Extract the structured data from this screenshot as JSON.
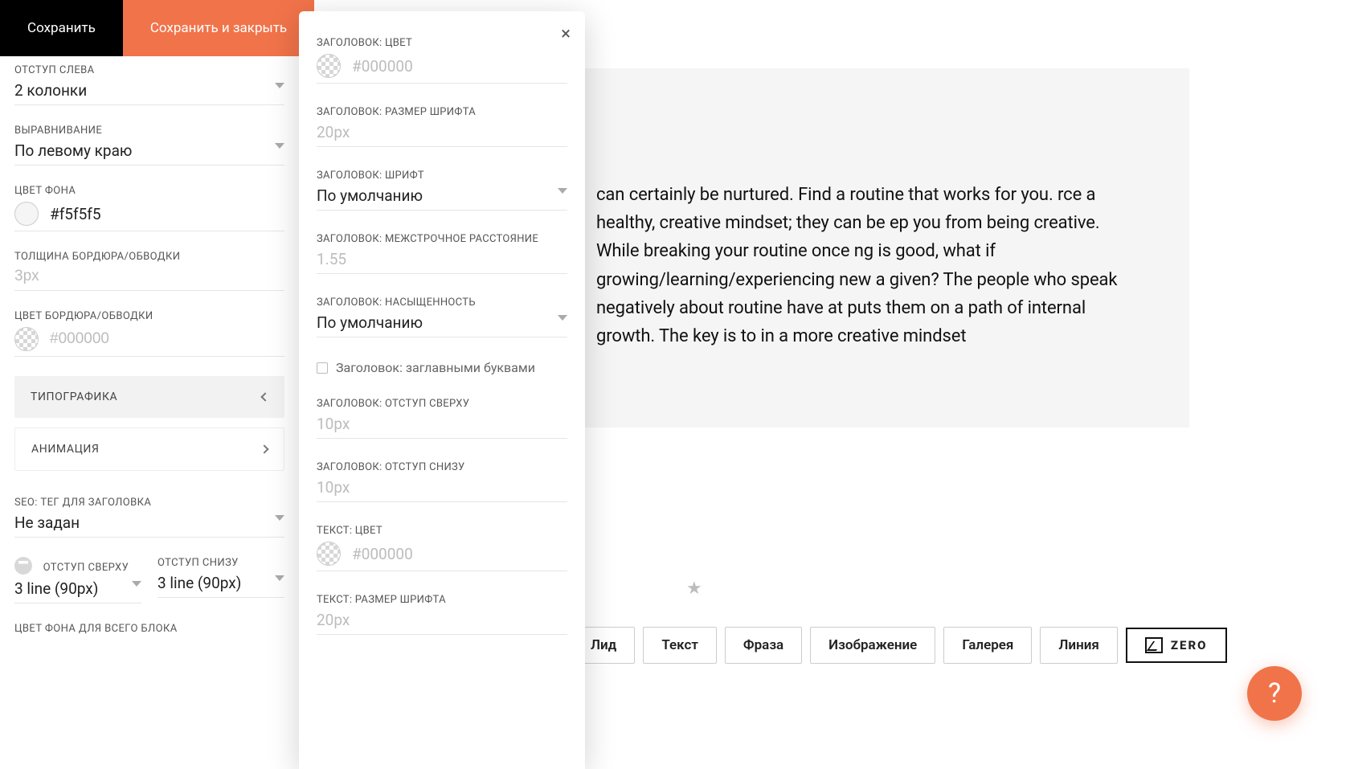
{
  "topbar": {
    "save": "Сохранить",
    "saveclose": "Сохранить и закрыть"
  },
  "sidebar": {
    "indent_left": {
      "label": "ОТСТУП СЛЕВА",
      "value": "2 колонки"
    },
    "align": {
      "label": "ВЫРАВНИВАНИЕ",
      "value": "По левому краю"
    },
    "bg_color": {
      "label": "ЦВЕТ ФОНА",
      "value": "#f5f5f5"
    },
    "border_w": {
      "label": "ТОЛЩИНА БОРДЮРА/ОБВОДКИ",
      "placeholder": "3px"
    },
    "border_c": {
      "label": "ЦВЕТ БОРДЮРА/ОБВОДКИ",
      "placeholder": "#000000"
    },
    "acc_typo": "ТИПОГРАФИКА",
    "acc_anim": "АНИМАЦИЯ",
    "seo": {
      "label": "SEO: ТЕГ ДЛЯ ЗАГОЛОВКА",
      "value": "Не задан"
    },
    "pad_top": {
      "label": "ОТСТУП СВЕРХУ",
      "value": "3 line (90px)"
    },
    "pad_bottom": {
      "label": "ОТСТУП СНИЗУ",
      "value": "3 line (90px)"
    },
    "block_bg": {
      "label": "ЦВЕТ ФОНА ДЛЯ ВСЕГО БЛОКА"
    }
  },
  "popup": {
    "title_color": {
      "label": "ЗАГОЛОВОК: ЦВЕТ",
      "placeholder": "#000000"
    },
    "title_size": {
      "label": "ЗАГОЛОВОК: РАЗМЕР ШРИФТА",
      "placeholder": "20px"
    },
    "title_font": {
      "label": "ЗАГОЛОВОК: ШРИФТ",
      "value": "По умолчанию"
    },
    "title_lh": {
      "label": "ЗАГОЛОВОК: МЕЖСТРОЧНОЕ РАССТОЯНИЕ",
      "placeholder": "1.55"
    },
    "title_weight": {
      "label": "ЗАГОЛОВОК: НАСЫЩЕННОСТЬ",
      "value": "По умолчанию"
    },
    "title_upper": "Заголовок: заглавными буквами",
    "title_mt": {
      "label": "ЗАГОЛОВОК: ОТСТУП СВЕРХУ",
      "placeholder": "10px"
    },
    "title_mb": {
      "label": "ЗАГОЛОВОК: ОТСТУП СНИЗУ",
      "placeholder": "10px"
    },
    "text_color": {
      "label": "ТЕКСТ: ЦВЕТ",
      "placeholder": "#000000"
    },
    "text_size": {
      "label": "ТЕКСТ: РАЗМЕР ШРИФТА",
      "placeholder": "20px"
    }
  },
  "canvas_text": " can certainly be nurtured. Find a routine that works for you. rce a healthy, creative mindset; they can be ep you from being creative. While breaking your routine once ng is good, what if growing/learning/experiencing new a given? The people who speak negatively about routine have at puts them on a path of internal growth. The key is to in a more creative mindset",
  "elbar": {
    "lead": "Лид",
    "text": "Текст",
    "phrase": "Фраза",
    "image": "Изображение",
    "gallery": "Галерея",
    "line": "Линия",
    "zero": "ZERO"
  },
  "help": "?"
}
